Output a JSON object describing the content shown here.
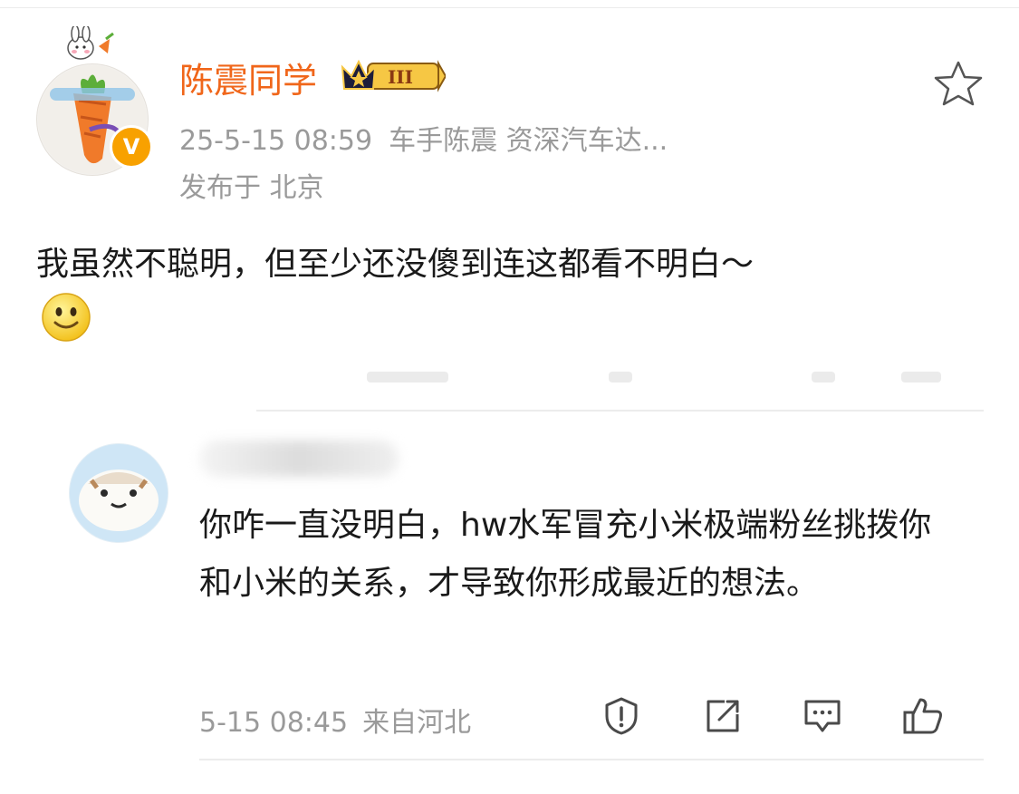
{
  "post": {
    "author": "陈震同学",
    "vip_level": "III",
    "timestamp": "25-5-15 08:59",
    "source": "车手陈震 资深汽车达...",
    "location": "发布于 北京",
    "content": "我虽然不聪明，但至少还没傻到连这都看不明白～",
    "verified_badge": "V",
    "emoji_icon": "smile-emoji"
  },
  "comment": {
    "text": "你咋一直没明白，hw水军冒充小米极端粉丝挑拨你和小米的关系，才导致你形成最近的想法。",
    "time": "5-15 08:45",
    "source": "来自河北",
    "actions": [
      "report-icon",
      "share-icon",
      "reply-icon",
      "like-icon"
    ]
  },
  "colors": {
    "author": "#f0661a",
    "meta": "#9a9a9a",
    "text": "#1a1a1a",
    "badge": "#f8a100"
  }
}
